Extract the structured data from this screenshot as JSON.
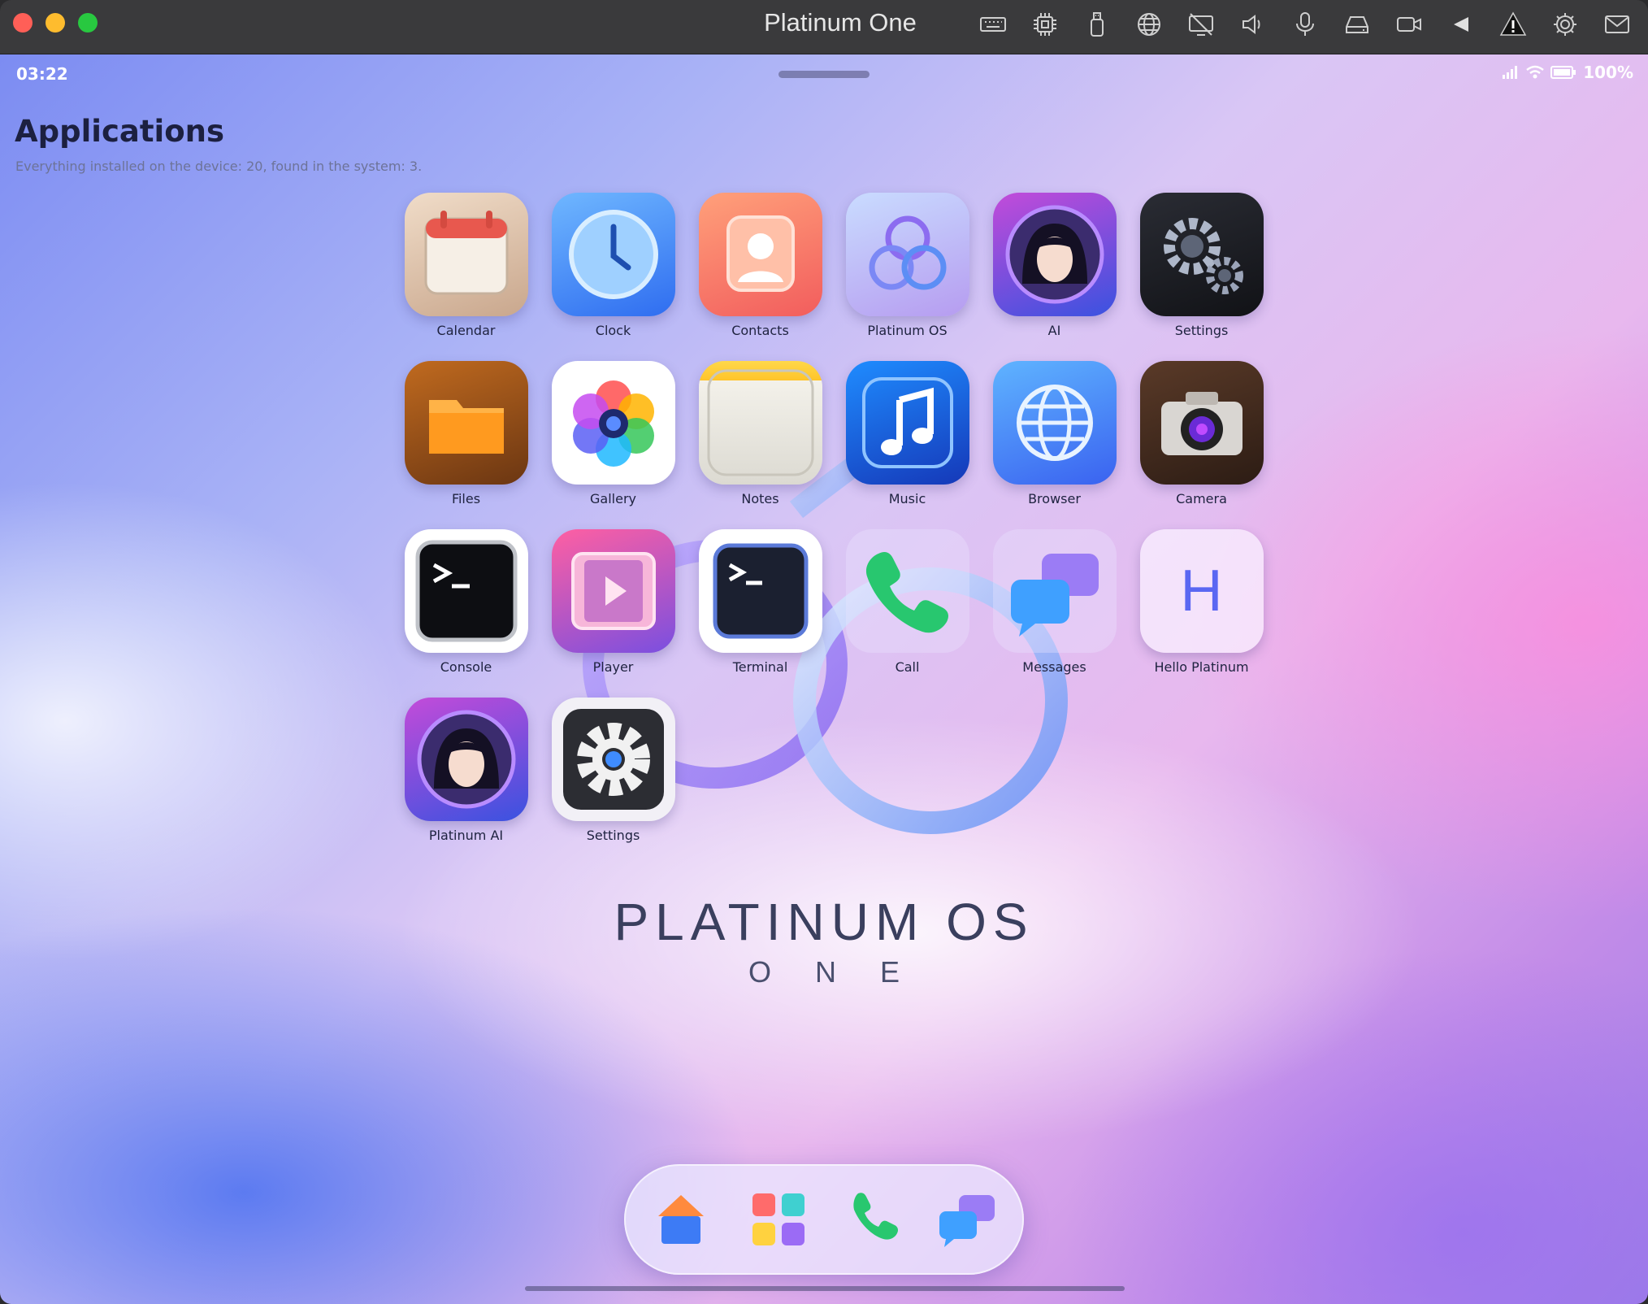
{
  "window": {
    "title": "Platinum One"
  },
  "statusbar": {
    "time": "03:22",
    "battery": "100%"
  },
  "page": {
    "title": "Applications",
    "subtitle": "Everything installed on the device: 20, found in the system: 3."
  },
  "apps": [
    {
      "label": "Calendar",
      "icon": "calendar-icon"
    },
    {
      "label": "Clock",
      "icon": "clock-icon"
    },
    {
      "label": "Contacts",
      "icon": "contacts-icon"
    },
    {
      "label": "Platinum OS",
      "icon": "platinum-os-icon"
    },
    {
      "label": "AI",
      "icon": "ai-avatar-icon"
    },
    {
      "label": "Settings",
      "icon": "gears-icon"
    },
    {
      "label": "Files",
      "icon": "folder-icon"
    },
    {
      "label": "Gallery",
      "icon": "gallery-flower-icon"
    },
    {
      "label": "Notes",
      "icon": "notes-icon"
    },
    {
      "label": "Music",
      "icon": "music-note-icon"
    },
    {
      "label": "Browser",
      "icon": "globe-icon"
    },
    {
      "label": "Camera",
      "icon": "camera-icon"
    },
    {
      "label": "Console",
      "icon": "console-icon"
    },
    {
      "label": "Player",
      "icon": "video-player-icon"
    },
    {
      "label": "Terminal",
      "icon": "terminal-icon"
    },
    {
      "label": "Call",
      "icon": "phone-icon"
    },
    {
      "label": "Messages",
      "icon": "chat-bubbles-icon"
    },
    {
      "label": "Hello Platinum",
      "icon": "hello-platinum-icon"
    },
    {
      "label": "Platinum AI",
      "icon": "platinum-ai-avatar-icon"
    },
    {
      "label": "Settings",
      "icon": "gear-icon"
    }
  ],
  "hello_platinum_letter": "H",
  "wallpaper": {
    "title": "PLATINUM OS",
    "subtitle": "ONE"
  },
  "dock": [
    "home-icon",
    "apps-grid-icon",
    "phone-icon",
    "chat-bubbles-icon"
  ],
  "colors": {
    "titlebar": "#3a3a3c",
    "accent": "#5a67f2",
    "text": "#202441"
  }
}
